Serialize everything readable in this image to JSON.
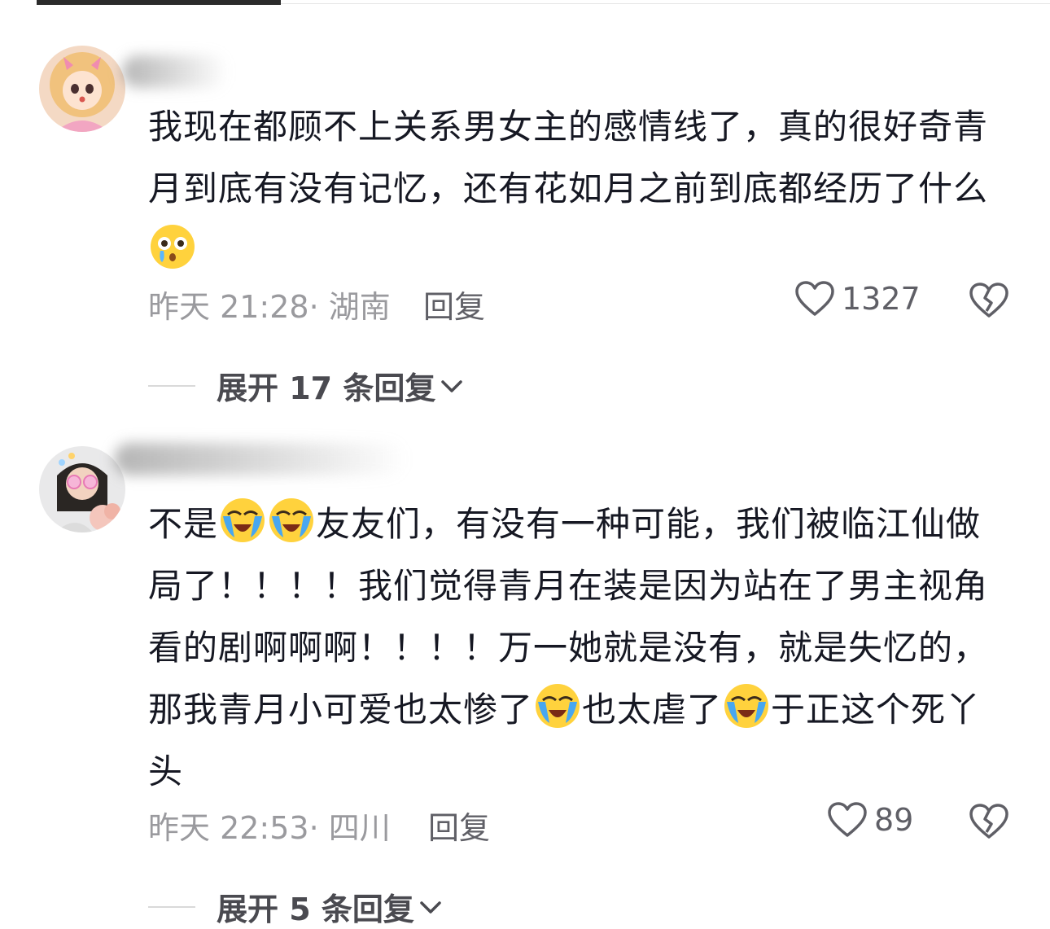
{
  "comments": [
    {
      "avatar_icon": "girl-avatar-icon",
      "body_parts": [
        "我现在都顾不上关系男女主的感情线了，真的很好奇青月到底有没有记忆，还有花如月之前到底都经历了什么"
      ],
      "time": "昨天 21:28",
      "location": "湖南",
      "reply_label": "回复",
      "likes": "1327",
      "expand_label": "展开 17 条回复"
    },
    {
      "avatar_icon": "girl-avatar-icon",
      "body_parts": [
        "不是",
        "友友们，有没有一种可能，我们被临江仙做局了！！！！我们觉得青月在装是因为站在了男主视角看的剧啊啊啊！！！！万一她就是没有，就是失忆的，那我青月小可爱也太惨了",
        "也太虐了",
        "于正这个死丫头"
      ],
      "time": "昨天 22:53",
      "location": "四川",
      "reply_label": "回复",
      "likes": "89",
      "expand_label": "展开 5 条回复"
    }
  ],
  "icons": {
    "like": "heart-outline-icon",
    "dislike": "broken-heart-icon",
    "expand": "chevron-down-icon",
    "emoji_1": "crying-pleading-emoji",
    "emoji_2": "loudly-crying-emoji"
  },
  "colors": {
    "text": "#161823",
    "meta": "#9a9a9e",
    "action": "#5f5f66"
  }
}
